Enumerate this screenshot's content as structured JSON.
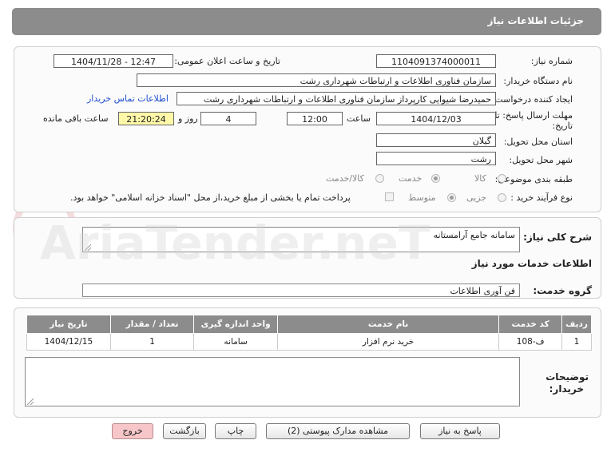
{
  "header": {
    "title": "جزئیات اطلاعات نیاز"
  },
  "form": {
    "need_number_label": "شماره نیاز:",
    "need_number": "1104091374000011",
    "announce_label": "تاریخ و ساعت اعلان عمومی:",
    "announce_value": "1404/11/28 - 12:47",
    "buyer_org_label": "نام دستگاه خریدار:",
    "buyer_org": "سازمان فناوری اطلاعات و ارتباطات شهرداری رشت",
    "creator_label": "ایجاد کننده درخواست:",
    "creator": "حمیدرضا شیوایی کارپرداز سازمان فناوری اطلاعات و ارتباطات شهرداری رشت",
    "contact_link": "اطلاعات تماس خریدار",
    "deadline_label_1": "مهلت ارسال پاسخ: تا",
    "deadline_label_2": "تاریخ:",
    "deadline_date": "1404/12/03",
    "time_label": "ساعت",
    "deadline_time": "12:00",
    "days": "4",
    "days_label": "روز و",
    "remaining": "21:20:24",
    "remaining_label": "ساعت باقی مانده",
    "province_label": "استان محل تحویل:",
    "province": "گیلان",
    "city_label": "شهر محل تحویل:",
    "city": "رشت",
    "category_label": "طبقه بندی موضوعی:",
    "category_options": [
      "کالا",
      "خدمت",
      "کالا/خدمت"
    ],
    "category_selected": "خدمت",
    "process_label": "نوع فرآیند خرید :",
    "process_options": [
      "جزیی",
      "متوسط"
    ],
    "process_selected": "متوسط",
    "payment_note": "پرداخت تمام یا بخشی از مبلغ خرید،از محل \"اسناد خزانه اسلامی\" خواهد بود."
  },
  "description": {
    "label": "شرح کلی نیاز:",
    "value": "سامانه جامع آرامستانه"
  },
  "services": {
    "section_title": "اطلاعات خدمات مورد نیاز",
    "group_label": "گروه خدمت:",
    "group_value": "فن آوری اطلاعات",
    "columns": [
      "ردیف",
      "کد خدمت",
      "نام خدمت",
      "واحد اندازه گیری",
      "تعداد / مقدار",
      "تاریخ نیاز"
    ],
    "rows": [
      {
        "row": "1",
        "code": "ف-108",
        "name": "خرید نرم افزار",
        "unit": "سامانه",
        "qty": "1",
        "date": "1404/12/15"
      }
    ]
  },
  "buyer_notes": {
    "label_1": "توضیحات",
    "label_2": "خریدار:",
    "value": ""
  },
  "buttons": {
    "reply": "پاسخ به نیاز",
    "attachments": "مشاهده مدارک پیوستی (2)",
    "print": "چاپ",
    "back": "بازگشت",
    "exit": "خروج"
  },
  "colors": {
    "header_bg": "#8c8c8c",
    "remaining_bg": "#fff8a8",
    "exit_bg": "#f6c6c9",
    "link": "#1f4fd0"
  }
}
